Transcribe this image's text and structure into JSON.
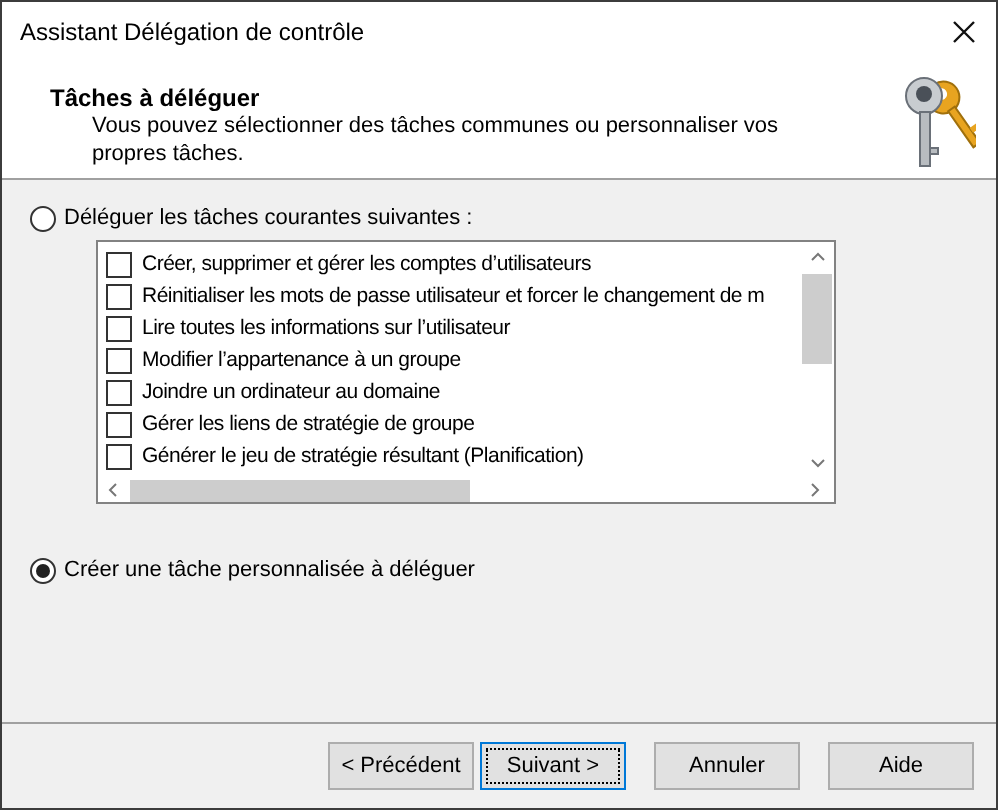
{
  "window": {
    "title": "Assistant Délégation de contrôle"
  },
  "header": {
    "title": "Tâches à déléguer",
    "subtitle": "Vous pouvez sélectionner des tâches communes ou personnaliser vos propres tâches."
  },
  "options": [
    {
      "label": "Déléguer les tâches courantes suivantes :",
      "selected": false,
      "tasks": [
        {
          "label": "Créer, supprimer et gérer les comptes d’utilisateurs",
          "checked": false
        },
        {
          "label": "Réinitialiser les mots de passe utilisateur et forcer le changement de m",
          "checked": false
        },
        {
          "label": "Lire toutes les informations sur l’utilisateur",
          "checked": false
        },
        {
          "label": "Modifier l’appartenance à un groupe",
          "checked": false
        },
        {
          "label": "Joindre un ordinateur au domaine",
          "checked": false
        },
        {
          "label": "Gérer les liens de stratégie de groupe",
          "checked": false
        },
        {
          "label": "Générer le jeu de stratégie résultant (Planification)",
          "checked": false
        }
      ]
    },
    {
      "label": "Créer une tâche personnalisée à déléguer",
      "selected": true
    }
  ],
  "buttons": [
    {
      "label": "< Précédent",
      "focused": false
    },
    {
      "label": "Suivant >",
      "focused": true
    },
    {
      "label": "Annuler",
      "focused": false
    },
    {
      "label": "Aide",
      "focused": false
    }
  ]
}
